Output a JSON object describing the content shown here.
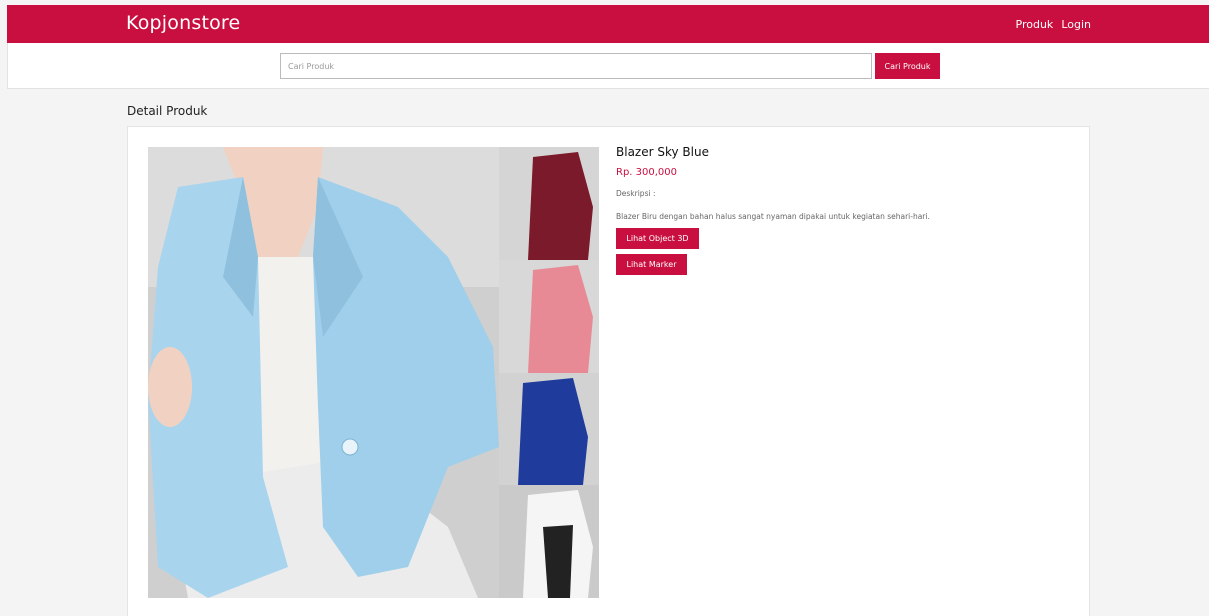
{
  "navbar": {
    "brand": "Kopjonstore",
    "links": [
      "Produk",
      "Login"
    ],
    "color": "#c90f3f"
  },
  "search": {
    "placeholder": "Cari Produk",
    "button_label": "Cari Produk"
  },
  "page": {
    "section_title": "Detail Produk"
  },
  "product": {
    "name": "Blazer Sky Blue",
    "price": "Rp. 300,000",
    "description_label": "Deskripsi :",
    "description": "Blazer Biru dengan bahan halus sangat nyaman dipakai untuk kegiatan sehari-hari.",
    "buttons": {
      "view_3d": "Lihat Object 3D",
      "view_marker": "Lihat Marker"
    },
    "variant_colors": [
      "#87cbe8",
      "#7a1a2a",
      "#e88a96",
      "#1f3c9c",
      "#f2f2f2"
    ]
  }
}
